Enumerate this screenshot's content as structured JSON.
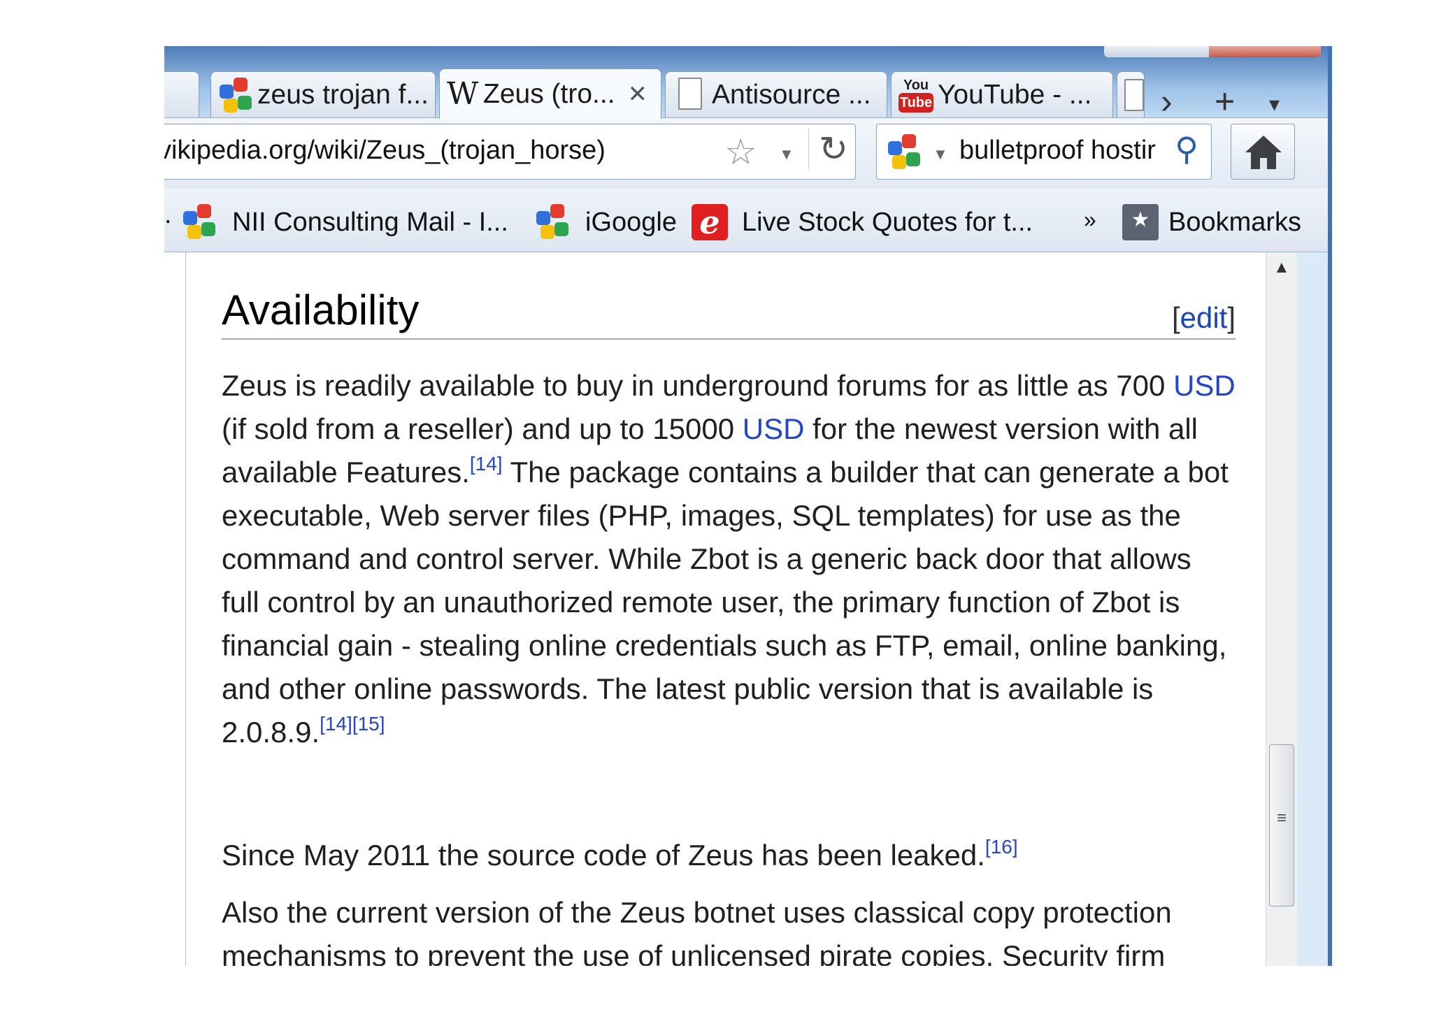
{
  "tabs": [
    {
      "label": "",
      "icon": "blank-tab-icon"
    },
    {
      "label": "zeus trojan f...",
      "icon": "google-icon"
    },
    {
      "label": "Zeus (tro...",
      "icon": "wikipedia-icon",
      "active": true,
      "close": "✕"
    },
    {
      "label": "Antisource ...",
      "icon": "page-icon"
    },
    {
      "label": "YouTube - ...",
      "icon": "youtube-icon",
      "yt_top": "You",
      "yt_bottom": "Tube"
    },
    {
      "label": "",
      "icon": "page-icon"
    }
  ],
  "tab_controls": {
    "scroll": "›",
    "new_tab": "+",
    "list": "▾"
  },
  "navbar": {
    "url": "vikipedia.org/wiki/Zeus_(trojan_horse)",
    "search_text": "bulletproof hostir"
  },
  "bookmarks": [
    {
      "label": "",
      "icon": "ellipsis"
    },
    {
      "label": "NII Consulting Mail - I...",
      "icon": "google-icon"
    },
    {
      "label": "iGoogle",
      "icon": "google-icon"
    },
    {
      "label": "Live Stock Quotes for t...",
      "icon": "etrade-icon",
      "glyph": "e"
    },
    {
      "label": "»",
      "icon": "chevron"
    },
    {
      "label": "Bookmarks",
      "icon": "bookmarks-icon"
    }
  ],
  "article": {
    "heading": "Availability",
    "edit": "edit",
    "p1": {
      "a": "Zeus is readily available to buy in underground forums for as little as 700 ",
      "usd1": "USD",
      "b": " (if sold from a reseller) and up to 15000 ",
      "usd2": "USD",
      "c": " for the newest version with all available Features.",
      "ref1": "[14]",
      "d": " The package contains a builder that can generate a bot executable, Web server files (PHP, images, SQL templates) for use as the command and control server. While Zbot is a generic back door that allows full control by an unauthorized remote user, the primary function of Zbot is financial gain - stealing online credentials such as FTP, email, online banking, and other online passwords. The latest public version that is available is 2.0.8.9.",
      "ref2": "[14]",
      "ref3": "[15]"
    },
    "p2": {
      "text": "Since May 2011 the source code of Zeus has been leaked.",
      "ref": "[16]"
    },
    "p3": {
      "text": "Also the current version of the Zeus botnet uses classical copy protection mechanisms to prevent the use of unlicensed pirate copies. Security firm SecureWorks has discovered that the Zeus server only works with a system"
    }
  }
}
